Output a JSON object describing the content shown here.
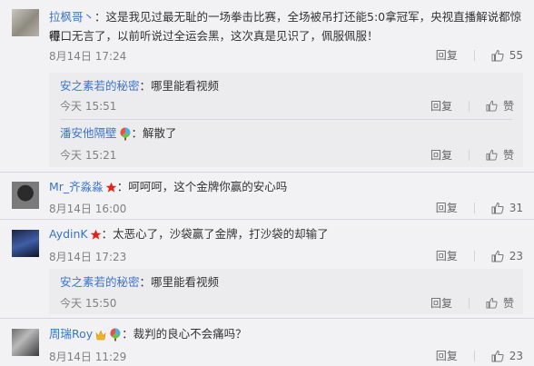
{
  "comments": [
    {
      "user": "拉枫哥丶",
      "text": "：这是我见过最无耻的一场拳击比赛，全场被吊打还能5:0拿冠军，央视直播解说都惊得哑口无言了，以前听说过全运会黑，这次真是见识了，佩服佩服！",
      "text_line1": "：这是我见过最无耻的一场拳击比赛，全场被吊打还能5:0拿冠军，央视直播解说都惊得",
      "text_line2": "哑口无言了，以前听说过全运会黑，这次真是见识了，佩服佩服！",
      "time": "8月14日 17:24",
      "reply_label": "回复",
      "like_count": "55",
      "replies": [
        {
          "user": "安之素若的秘密",
          "text": "：哪里能看视频",
          "time": "今天 15:51",
          "reply_label": "回复",
          "like_label": "赞"
        },
        {
          "user": "潘安他隔壁",
          "text": "：解散了",
          "time": "今天 15:21",
          "reply_label": "回复",
          "like_label": "赞"
        }
      ]
    },
    {
      "user": "Mr_齐淼淼",
      "text": "：呵呵呵，这个金牌你赢的安心吗",
      "time": "8月14日 16:00",
      "reply_label": "回复",
      "like_count": "31",
      "replies": []
    },
    {
      "user": "AydinK",
      "text": "：太恶心了，沙袋赢了金牌，打沙袋的却输了",
      "time": "8月14日 17:23",
      "reply_label": "回复",
      "like_count": "23",
      "replies": [
        {
          "user": "安之素若的秘密",
          "text": "：哪里能看视频",
          "time": "今天 15:50",
          "reply_label": "回复",
          "like_label": "赞"
        }
      ]
    },
    {
      "user": "周瑞Roy",
      "text": "：裁判的良心不会痛吗？",
      "time": "8月14日 11:29",
      "reply_label": "回复",
      "like_count": "23",
      "replies": []
    }
  ],
  "colors": {
    "username": "#3a73c8",
    "text": "#333333",
    "meta": "#808080",
    "background": "#f2f2f5",
    "reply_background": "#ececef",
    "star_badge": "#e2231a"
  },
  "icons": [
    "thumb-up-icon",
    "star-badge-icon",
    "balloon-badge-icon",
    "vip-badge-icon"
  ]
}
